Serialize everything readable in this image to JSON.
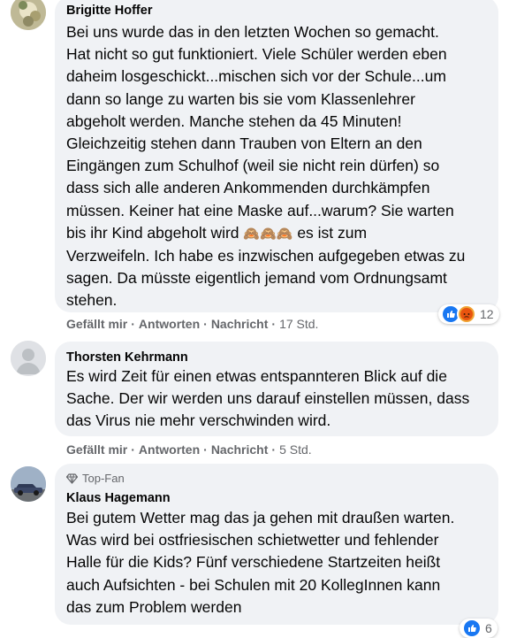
{
  "comments": [
    {
      "author": "Brigitte Hoffer",
      "lines": [
        "Bei uns wurde das in den letzten Wochen so gemacht.",
        "Hat nicht so gut funktioniert. Viele Schüler werden eben",
        "daheim losgeschickt...mischen sich vor der Schule...um",
        "dann so lange zu warten bis sie vom Klassenlehrer",
        "abgeholt werden. Manche stehen da 45 Minuten!",
        "Gleichzeitig stehen dann Trauben von Eltern an den",
        "Eingängen zum Schulhof (weil sie nicht rein dürfen) so",
        "dass sich alle anderen Ankommenden durchkämpfen",
        "müssen. Keiner hat eine Maske auf...warum? Sie warten"
      ],
      "line_emoji_prefix": "bis ihr Kind abgeholt wird",
      "line_emoji": "🙈🙈🙈",
      "line_emoji_suffix": "es ist zum",
      "lines_after": [
        "Verzweifeln. Ich habe es inzwischen aufgegeben etwas zu",
        "sagen. Da müsste eigentlich jemand vom Ordnungsamt",
        "stehen."
      ],
      "like_label": "Gefällt mir",
      "reply_label": "Antworten",
      "message_label": "Nachricht",
      "time": "17 Std.",
      "reaction_count": "12",
      "reaction_icons": [
        "like-icon",
        "angry-icon"
      ]
    },
    {
      "author": "Thorsten Kehrmann",
      "lines": [
        "Es wird Zeit für einen etwas entspannteren Blick auf die",
        "Sache. Der wir werden uns darauf einstellen müssen, dass",
        "das Virus nie mehr verschwinden wird."
      ],
      "like_label": "Gefällt mir",
      "reply_label": "Antworten",
      "message_label": "Nachricht",
      "time": "5 Std."
    },
    {
      "badge": "Top-Fan",
      "author": "Klaus Hagemann",
      "lines": [
        "Bei gutem Wetter mag das ja gehen mit draußen warten.",
        "Was wird bei ostfriesischen schietwetter und fehlender",
        "Halle für die Kids? Fünf verschiedene Startzeiten heißt",
        "auch Aufsichten - bei Schulen mit 20 KollegInnen kann",
        "das zum Problem werden"
      ],
      "reaction_count": "6",
      "reaction_icons": [
        "like-icon"
      ]
    }
  ],
  "colors": {
    "like": "#1877f2",
    "angry": "#f0a434",
    "bubble": "#f0f2f5",
    "meta": "#65676b"
  }
}
